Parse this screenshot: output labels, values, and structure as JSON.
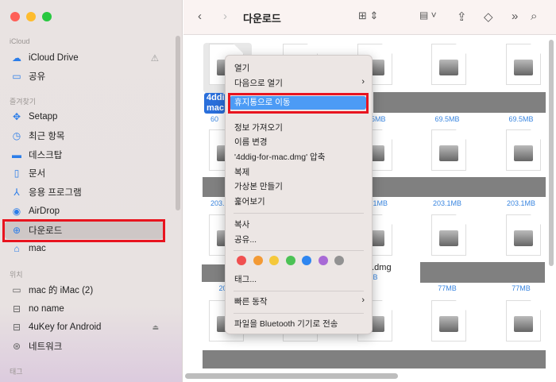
{
  "window": {
    "title": "다운로드"
  },
  "sidebar": {
    "sections": [
      {
        "label": "iCloud",
        "items": [
          {
            "label": "iCloud Drive",
            "icon": "cloud-icon"
          },
          {
            "label": "공유",
            "icon": "shared-folder-icon"
          }
        ]
      },
      {
        "label": "즐겨찾기",
        "items": [
          {
            "label": "Setapp",
            "icon": "setapp-icon"
          },
          {
            "label": "최근 항목",
            "icon": "clock-icon"
          },
          {
            "label": "데스크탑",
            "icon": "desktop-icon"
          },
          {
            "label": "문서",
            "icon": "document-icon"
          },
          {
            "label": "응용 프로그램",
            "icon": "applications-icon"
          },
          {
            "label": "AirDrop",
            "icon": "airdrop-icon"
          },
          {
            "label": "다운로드",
            "icon": "download-icon",
            "selected": true
          },
          {
            "label": "mac",
            "icon": "home-icon"
          }
        ]
      },
      {
        "label": "위치",
        "items": [
          {
            "label": "mac 的 iMac (2)",
            "icon": "imac-icon"
          },
          {
            "label": "no name",
            "icon": "drive-icon"
          },
          {
            "label": "4uKey for Android",
            "icon": "drive-icon"
          },
          {
            "label": "네트워크",
            "icon": "network-icon"
          }
        ]
      },
      {
        "label": "태그",
        "items": []
      }
    ]
  },
  "files": {
    "selected_label": "4ddig-for-mac.dmg",
    "selected_label_short": "4ddi mac",
    "selected_size_partial": "60",
    "sizes_row1": [
      "69.5MB",
      "69.5MB",
      "69.5MB"
    ],
    "sizes_row2": [
      "203.1MB",
      "203.1MB",
      "203.1MB",
      "203.1MB"
    ],
    "row3_partial_name": "o.dmg",
    "row3_partial_size": ".2MB",
    "sizes_row3": [
      "203",
      "77MB",
      "77MB"
    ]
  },
  "context_menu": {
    "items": [
      "열기",
      "다음으로 열기",
      "휴지통으로 이동",
      "정보 가져오기",
      "이름 변경",
      "'4ddig-for-mac.dmg' 압축",
      "복제",
      "가상본 만들기",
      "훑어보기",
      "복사",
      "공유...",
      "태그...",
      "빠른 동작",
      "파일을 Bluetooth 기기로 전송"
    ],
    "tag_colors": [
      "#f05050",
      "#f39a35",
      "#f5c83a",
      "#4cc255",
      "#2f86f0",
      "#a86ad6",
      "#929292"
    ]
  },
  "colors": {
    "accent": "#2b7de9",
    "highlight": "#e8141f"
  }
}
